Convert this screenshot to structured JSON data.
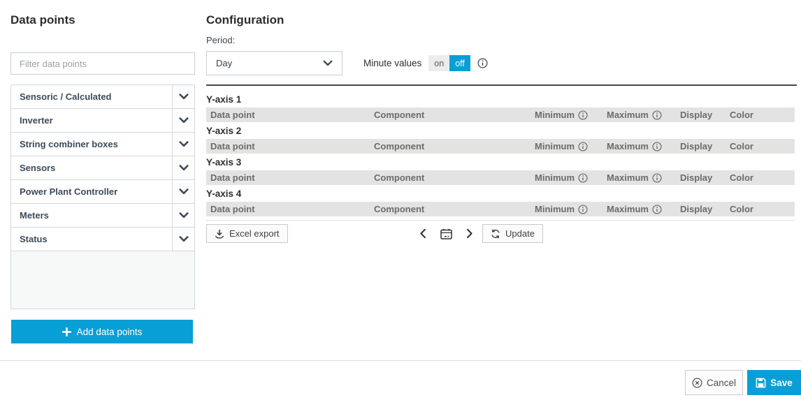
{
  "left_panel": {
    "title": "Data points",
    "filter_placeholder": "Filter data points",
    "categories": [
      {
        "label": "Sensoric / Calculated"
      },
      {
        "label": "Inverter"
      },
      {
        "label": "String combiner boxes"
      },
      {
        "label": "Sensors"
      },
      {
        "label": "Power Plant Controller"
      },
      {
        "label": "Meters"
      },
      {
        "label": "Status"
      }
    ],
    "add_button_label": "Add data points"
  },
  "config": {
    "title": "Configuration",
    "period_label": "Period:",
    "period_value": "Day",
    "minute_values_label": "Minute values",
    "minute_on_label": "on",
    "minute_off_label": "off",
    "minute_values_state": "off",
    "axes": [
      {
        "label": "Y-axis 1"
      },
      {
        "label": "Y-axis 2"
      },
      {
        "label": "Y-axis 3"
      },
      {
        "label": "Y-axis 4"
      }
    ],
    "table_headers": [
      "Data point",
      "Component",
      "Minimum",
      "Maximum",
      "Display",
      "Color"
    ],
    "excel_export_label": "Excel export",
    "update_label": "Update"
  },
  "footer": {
    "cancel_label": "Cancel",
    "save_label": "Save"
  },
  "colors": {
    "accent": "#089fd6",
    "header_row_bg": "#e1e4e0"
  }
}
